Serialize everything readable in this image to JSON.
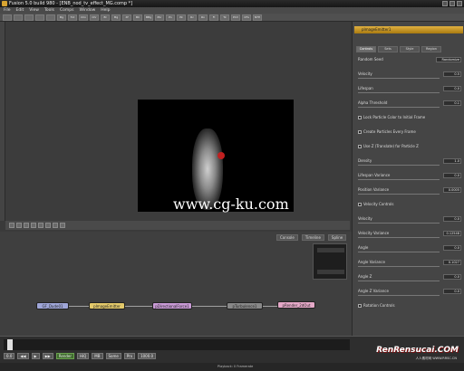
{
  "window": {
    "title": "Fusion 5.0 build 980 - [ENB_nod_tv_effect_MG.comp *]"
  },
  "menubar": [
    "File",
    "Edit",
    "View",
    "Tools",
    "Comps",
    "Window",
    "Help"
  ],
  "toolbar": [
    "",
    "",
    "",
    "",
    "",
    "Bg",
    "Txt",
    "CCn",
    "Chr",
    "Bl",
    "Mg",
    "Xf",
    "BC",
    "MBg",
    "Pbr",
    "Pn",
    "Pk",
    "Rc",
    "Rn",
    "Fl",
    "Tk",
    "PCV",
    "CFA",
    "NTH"
  ],
  "viewer": {
    "label": "ViewL1"
  },
  "watermark": "www.cg-ku.com",
  "flow": {
    "tabs": [
      "Console",
      "Timeline",
      "Spline"
    ],
    "nodes": [
      {
        "label": "GF_Dude01",
        "color": "#9fa6d8"
      },
      {
        "label": "pImageEmitter",
        "color": "#e3c96a"
      },
      {
        "label": "pDirectionalForce1",
        "color": "#c99ad6"
      },
      {
        "label": "pTurbulence1",
        "color": "#888888"
      },
      {
        "label": "pRender_2dOut",
        "color": "#e5a9c8"
      }
    ]
  },
  "panel": {
    "header": "pImageEmitter1",
    "tabs": [
      "Controls",
      "Sets",
      "Style",
      "Region"
    ],
    "rows": [
      {
        "label": "Random Seed",
        "value": "",
        "slider": false,
        "check": false,
        "btn": "Randomize"
      },
      {
        "label": "Velocity",
        "value": "0.5",
        "slider": true,
        "check": false
      },
      {
        "label": "Lifespan",
        "value": "0.0",
        "slider": true,
        "check": false
      },
      {
        "label": "Alpha Threshold",
        "value": "0.1",
        "slider": true,
        "check": false
      },
      {
        "label": "Lock Particle Color to Initial Frame",
        "value": "",
        "slider": false,
        "check": true
      },
      {
        "label": "Create Particles Every Frame",
        "value": "",
        "slider": false,
        "check": true
      },
      {
        "label": "Use Z (Translate) for Particle Z",
        "value": "",
        "slider": false,
        "check": true
      },
      {
        "label": "Density",
        "value": "1.0",
        "slider": true,
        "check": false
      },
      {
        "label": "Lifespan Variance",
        "value": "0.0",
        "slider": true,
        "check": false
      },
      {
        "label": "Position Variance",
        "value": "0.0005",
        "slider": true,
        "check": false
      },
      {
        "label": "Velocity Controls",
        "value": "",
        "slider": false,
        "check": true
      },
      {
        "label": "Velocity",
        "value": "0.0",
        "slider": true,
        "check": false
      },
      {
        "label": "Velocity Variance",
        "value": "0.12548",
        "slider": true,
        "check": false
      },
      {
        "label": "Angle",
        "value": "0.0",
        "slider": true,
        "check": false
      },
      {
        "label": "Angle Variance",
        "value": "0.1027",
        "slider": true,
        "check": false
      },
      {
        "label": "Angle Z",
        "value": "0.0",
        "slider": true,
        "check": false
      },
      {
        "label": "Angle Z Variance",
        "value": "0.0",
        "slider": true,
        "check": false
      },
      {
        "label": "Rotation Controls",
        "value": "",
        "slider": false,
        "check": true
      }
    ]
  },
  "timeline": {
    "start": "0.0",
    "end": "1000.0",
    "buttons": [
      "Render",
      "HiQ",
      "MB",
      "Some",
      "Prx"
    ],
    "status": "Playback: 0 Framerate"
  },
  "watermark2": {
    "title": "RenRensucai.COM",
    "sub": "人人素材网 WWW.RRSC.CN"
  }
}
